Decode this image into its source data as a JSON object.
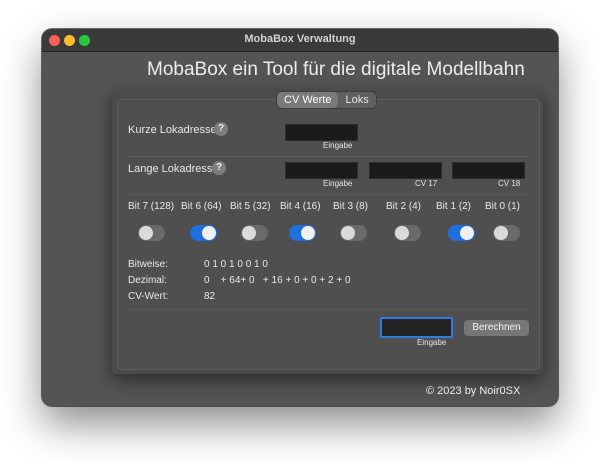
{
  "window": {
    "title": "MobaBox Verwaltung"
  },
  "heading": "MobaBox ein Tool für die digitale Modellbahn",
  "tabs": [
    {
      "label": "CV Werte",
      "active": true
    },
    {
      "label": "Loks",
      "active": false
    }
  ],
  "short_address": {
    "label": "Kurze Lokadresse",
    "help": "?",
    "caption": "Eingabe"
  },
  "long_address": {
    "label": "Lange Lokadresse",
    "help": "?",
    "fields": [
      {
        "caption": "Eingabe"
      },
      {
        "caption": "CV 17"
      },
      {
        "caption": "CV 18"
      }
    ]
  },
  "bits": [
    {
      "label": "Bit 7 (128)",
      "on": false
    },
    {
      "label": "Bit 6 (64)",
      "on": true
    },
    {
      "label": "Bit 5 (32)",
      "on": false
    },
    {
      "label": "Bit 4 (16)",
      "on": true
    },
    {
      "label": "Bit 3 (8)",
      "on": false
    },
    {
      "label": "Bit 2 (4)",
      "on": false
    },
    {
      "label": "Bit 1 (2)",
      "on": true
    },
    {
      "label": "Bit 0 (1)",
      "on": false
    }
  ],
  "results": {
    "bitweise_label": "Bitweise:",
    "bitweise_value": "0 1 0 1 0 0 1 0",
    "dezimal_label": "Dezimal:",
    "dezimal_value": "0    + 64+ 0   + 16 + 0 + 0 + 2 + 0",
    "cvwert_label": "CV-Wert:",
    "cvwert_value": "82"
  },
  "calc": {
    "input_caption": "Eingabe",
    "button_label": "Berechnen"
  },
  "copyright": "© 2023 by Noir0SX",
  "colors": {
    "toggle_on": "#1f6fde",
    "input_focus": "#2f7be0",
    "window_bg": "#545454"
  }
}
